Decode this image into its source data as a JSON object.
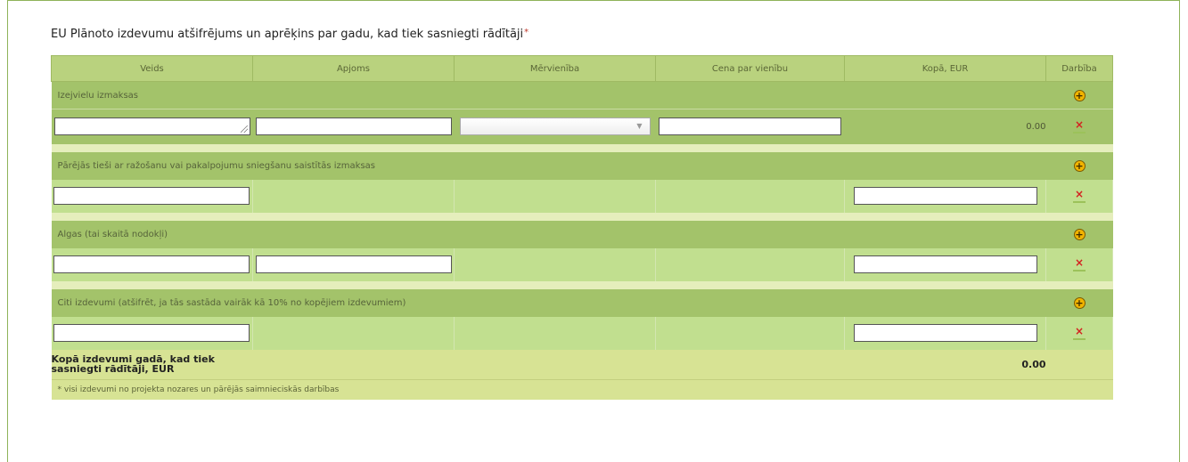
{
  "title": "EU Plānoto izdevumu atšifrējums un aprēķins par gadu, kad tiek sasniegti rādītāji",
  "required_mark": "*",
  "columns": [
    "Veids",
    "Apjoms",
    "Mērvienība",
    "Cena par vienību",
    "Kopā, EUR",
    "Darbība"
  ],
  "sections": [
    {
      "label": "Izejvielu izmaksas",
      "total": "0.00"
    },
    {
      "label": "Pārējās tieši ar ražošanu vai pakalpojumu sniegšanu saistītās izmaksas"
    },
    {
      "label": "Algas (tai skaitā nodokļi)"
    },
    {
      "label": "Citi izdevumi (atšifrēt, ja tās sastāda vairāk kā 10% no kopējiem izdevumiem)"
    }
  ],
  "icons": {
    "add": "+",
    "delete": "×"
  },
  "total": {
    "label": "Kopā izdevumi gadā, kad tiek sasniegti rādītāji, EUR",
    "value": "0.00"
  },
  "footnote": "* visi izdevumi no projekta nozares un pārējās saimnieciskās darbības",
  "colors": {
    "header": "#b9d27e",
    "section": "#a3c36a",
    "row": "#c1df8f",
    "total": "#d7e394",
    "border": "#8fb35a"
  }
}
